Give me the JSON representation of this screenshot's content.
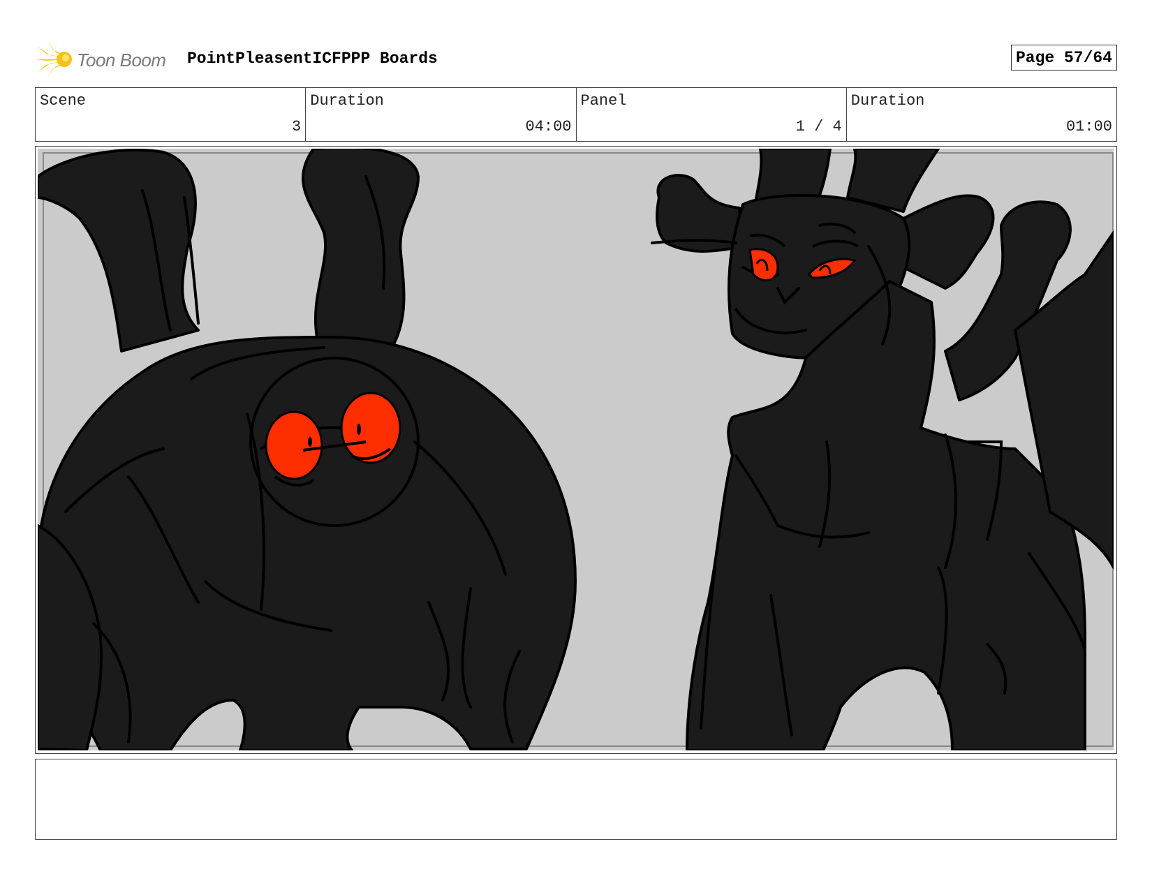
{
  "header": {
    "logo_text": "Toon Boom",
    "project_title": "PointPleasentICFPPP Boards",
    "page_label": "Page 57/64"
  },
  "info": {
    "scene_label": "Scene",
    "scene_value": "3",
    "scene_duration_label": "Duration",
    "scene_duration_value": "04:00",
    "panel_label": "Panel",
    "panel_value": "1 / 4",
    "panel_duration_label": "Duration",
    "panel_duration_value": "01:00"
  },
  "colors": {
    "creature_fill": "#1b1b1b",
    "eye_red": "#ff2e00",
    "background_gray": "#cbcbcb",
    "logo_yellow": "#f6c21a"
  },
  "notes": {
    "text": ""
  }
}
